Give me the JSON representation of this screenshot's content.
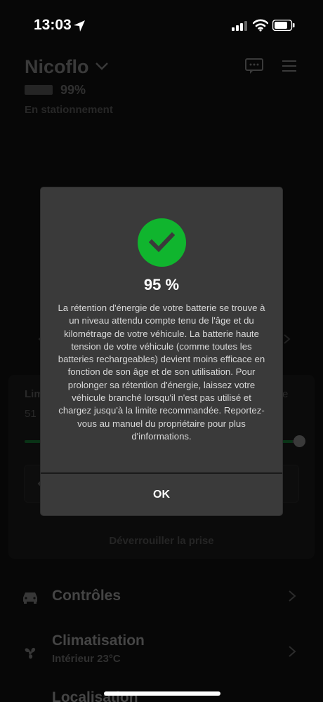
{
  "status_bar": {
    "time": "13:03"
  },
  "vehicle": {
    "name": "Nicoflo",
    "battery_percent": "99%",
    "state": "En stationnement"
  },
  "charging": {
    "limit_label": "Lim",
    "range_value": "51",
    "right_label": "e",
    "unlock_port_label": "Déverrouiller la prise"
  },
  "menu": [
    {
      "label": "Contrôles",
      "sub": ""
    },
    {
      "label": "Climatisation",
      "sub": "Intérieur 23°C"
    },
    {
      "label": "Localisation",
      "sub": ""
    }
  ],
  "dialog": {
    "percent": "95 %",
    "body": "La rétention d'énergie de votre batterie se trouve à un niveau attendu compte tenu de l'âge et du kilométrage de votre véhicule. La batterie haute tension de votre véhicule (comme toutes les batteries rechargeables) devient moins efficace en fonction de son âge et de son utilisation. Pour prolonger sa rétention d'énergie, laissez votre véhicule branché lorsqu'il n'est pas utilisé et chargez jusqu'à la limite recommandée. Reportez-vous au manuel du propriétaire pour plus d'informations.",
    "ok_label": "OK"
  },
  "colors": {
    "accent_green": "#10b52e",
    "dialog_bg": "#3a3a3a",
    "background": "#0b0b0b"
  },
  "icons": [
    "location-arrow-icon",
    "signal-icon",
    "wifi-icon",
    "battery-icon",
    "chevron-down-icon",
    "chat-icon",
    "menu-icon",
    "checkmark-icon",
    "car-icon",
    "fan-icon",
    "chevron-right-icon"
  ]
}
